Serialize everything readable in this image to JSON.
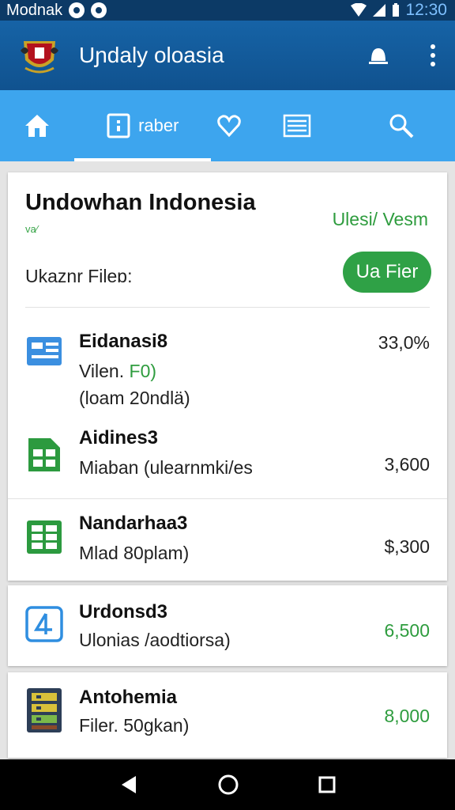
{
  "status_bar": {
    "carrier": "Modnak",
    "time": "12:30"
  },
  "app_bar": {
    "title": "Uɲdaly oloasia"
  },
  "tabs": [
    {
      "icon": "home-icon",
      "label": ""
    },
    {
      "icon": "document-icon",
      "label": "raber"
    },
    {
      "icon": "heart-icon",
      "label": ""
    },
    {
      "icon": "list-icon",
      "label": ""
    },
    {
      "icon": "bookmark-icon",
      "label": ""
    },
    {
      "icon": "search-icon",
      "label": ""
    }
  ],
  "section": {
    "title": "Undowhan Indonesia",
    "subtitle": "va⁄",
    "right_label": "Ulesi/ Vesm",
    "filter_label": "Ukaznr Fileɒ:",
    "filter_button": "Ua Fier"
  },
  "downloads": [
    {
      "icon": "file-blue-icon",
      "name": "Eidanasi8",
      "line2": "Vilen. ",
      "line2_green": "F0)",
      "line3": "(loam 20ndlä)",
      "value": "33,0%",
      "value_green": false
    },
    {
      "icon": "sheet-green-icon",
      "name": "Aidines3",
      "line2": "Miaban (ulearnmki/es",
      "line2_green": "",
      "line3": "",
      "value": "3,600",
      "value_green": false
    },
    {
      "icon": "grid-green-icon",
      "name": "Nandarhaa3",
      "line2": "Mlad 80plam)",
      "line2_green": "",
      "line3": "",
      "value": "$,300",
      "value_green": false
    },
    {
      "icon": "app-blue-icon",
      "name": "Urdonsd3",
      "line2": "Ulonias /aodtiorsa)",
      "line2_green": "",
      "line3": "",
      "value": "6,500",
      "value_green": true
    },
    {
      "icon": "archive-icon",
      "name": "Antohemia",
      "line2": "Filer. 50gkan)",
      "line2_green": "",
      "line3": "",
      "value": "8,000",
      "value_green": true
    }
  ]
}
